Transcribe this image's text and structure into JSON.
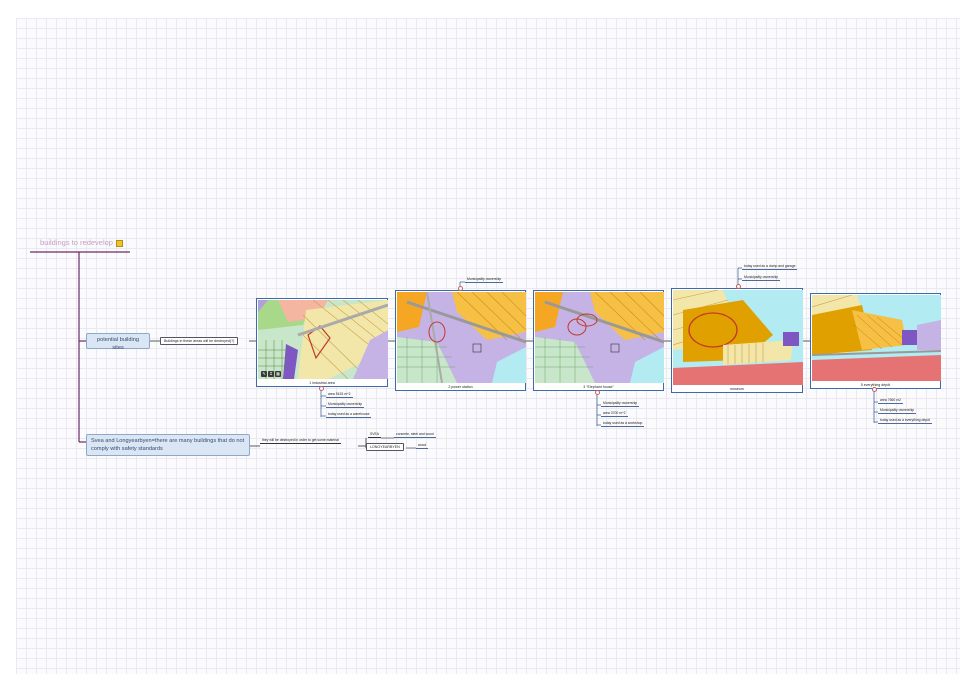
{
  "root": {
    "title": "buildings to redevelop",
    "icon": "note-icon"
  },
  "branches": {
    "sites": "potential building sites",
    "standards": "Svea and Longyearbyen=there are many buildings that do not comply with safety standards"
  },
  "sites_sub": "Buildings in these areas will be destroyed(?)",
  "standards_sub": "they will be destroyed in order to get some material",
  "materials": [
    {
      "place": "SVEA",
      "material": "concrete, steel and wood"
    },
    {
      "place": "LONGYEARBYEN",
      "material": "wood"
    }
  ],
  "maps": [
    {
      "caption": "1 industrial area",
      "above": [],
      "below": [
        "area 9415 m^2",
        "Municipality ownership",
        "today used as a warehouse"
      ]
    },
    {
      "caption": "2 power station",
      "above": [
        "Municipality ownership"
      ],
      "below": []
    },
    {
      "caption": "3 \"Elephant house\"",
      "above": [],
      "below": [
        "Municipality ownership",
        "area 3700 m^2",
        "today used as a workshop"
      ]
    },
    {
      "caption": "museum",
      "above": [
        "today used as a dump and garage",
        "Municipality ownership"
      ],
      "below": []
    },
    {
      "caption": "5 everything dépôt",
      "above": [],
      "below": [
        "area 7660 m2",
        "Municipality ownership",
        "today used as a everything dépôt"
      ]
    }
  ],
  "colors": {
    "branch_line": "#6b2a66",
    "box_fill": "#dbe6f5",
    "map_border": "#3d6aa8",
    "orange": "#f5a623",
    "violet": "#b39ddb",
    "green": "#a5d6a7",
    "cyan": "#b2ebf2",
    "red_outline": "#c0392b"
  }
}
